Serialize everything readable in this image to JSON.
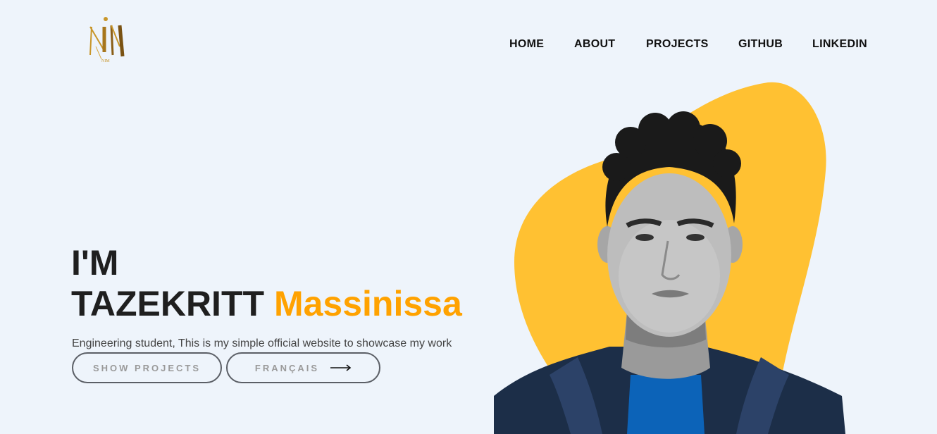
{
  "logo": {
    "letters": "NM",
    "caption": "NIM"
  },
  "nav": {
    "items": [
      {
        "label": "HOME"
      },
      {
        "label": "ABOUT"
      },
      {
        "label": "PROJECTS"
      },
      {
        "label": "GITHUB"
      },
      {
        "label": "LINKEDIN"
      }
    ]
  },
  "hero": {
    "line1": "I'M",
    "last_name": "TAZEKRITT",
    "first_name": "Massinissa",
    "subtitle": "Engineering student, This is my simple official website to showcase my work"
  },
  "buttons": {
    "show_projects": "SHOW PROJECTS",
    "language": "FRANÇAIS"
  },
  "colors": {
    "background": "#eef4fb",
    "accent": "#ffa200",
    "blob": "#ffc132",
    "text": "#1f1f1f",
    "button_border": "#5b5f66"
  },
  "portrait": {
    "icon": "person-photo"
  }
}
